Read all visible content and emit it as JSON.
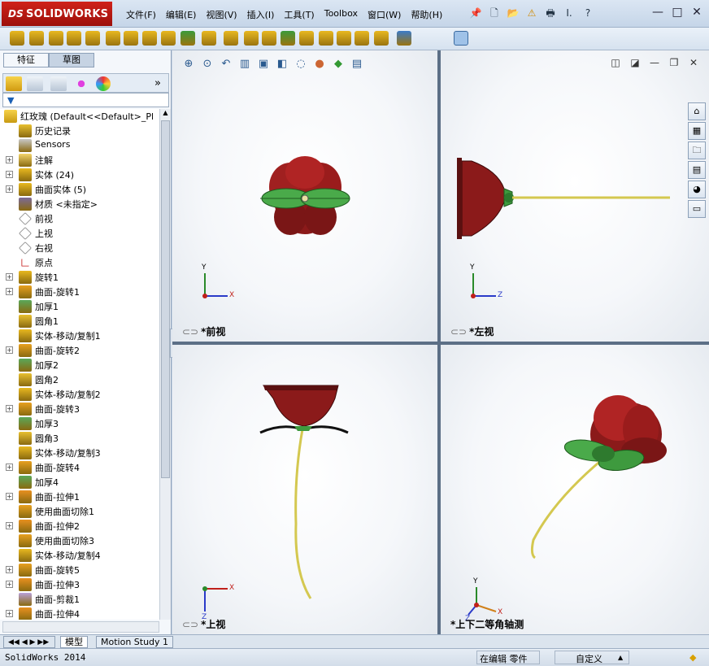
{
  "app": {
    "logo_prefix": "DS",
    "logo_text": "SOLIDWORKS"
  },
  "menu": [
    "文件(F)",
    "编辑(E)",
    "视图(V)",
    "插入(I)",
    "工具(T)",
    "Toolbox",
    "窗口(W)",
    "帮助(H)"
  ],
  "topicons": [
    "pin-icon",
    "new-document-icon",
    "open-icon",
    "rebuild-warning-icon",
    "print-icon",
    "measure-icon",
    "help-icon"
  ],
  "window_buttons": [
    "—",
    "□",
    "✕"
  ],
  "feature_tabs": [
    "特征",
    "草图"
  ],
  "manager_buttons": [
    "feature-manager-icon",
    "property-manager-icon",
    "configuration-manager-icon",
    "dimxpert-icon",
    "display-manager-icon"
  ],
  "tree": {
    "root": "红玫瑰  (Default<<Default>_Pl",
    "items": [
      {
        "label": "历史记录",
        "icon": "history-icon",
        "exp": false
      },
      {
        "label": "Sensors",
        "icon": "sensors-icon",
        "exp": false
      },
      {
        "label": "注解",
        "icon": "annotations-icon",
        "exp": true
      },
      {
        "label": "实体 (24)",
        "icon": "solid-bodies-icon",
        "exp": true
      },
      {
        "label": "曲面实体 (5)",
        "icon": "surface-bodies-icon",
        "exp": true
      },
      {
        "label": "材质 <未指定>",
        "icon": "material-icon",
        "exp": false
      },
      {
        "label": "前视",
        "icon": "plane-icon",
        "exp": false
      },
      {
        "label": "上视",
        "icon": "plane-icon",
        "exp": false
      },
      {
        "label": "右视",
        "icon": "plane-icon",
        "exp": false
      },
      {
        "label": "原点",
        "icon": "origin-icon",
        "exp": false
      },
      {
        "label": "旋转1",
        "icon": "revolve-icon",
        "exp": true
      },
      {
        "label": "曲面-旋转1",
        "icon": "surface-revolve-icon",
        "exp": true
      },
      {
        "label": "加厚1",
        "icon": "thicken-icon",
        "exp": false
      },
      {
        "label": "圆角1",
        "icon": "fillet-icon",
        "exp": false
      },
      {
        "label": "实体-移动/复制1",
        "icon": "move-copy-icon",
        "exp": false
      },
      {
        "label": "曲面-旋转2",
        "icon": "surface-revolve-icon",
        "exp": true
      },
      {
        "label": "加厚2",
        "icon": "thicken-icon",
        "exp": false
      },
      {
        "label": "圆角2",
        "icon": "fillet-icon",
        "exp": false
      },
      {
        "label": "实体-移动/复制2",
        "icon": "move-copy-icon",
        "exp": false
      },
      {
        "label": "曲面-旋转3",
        "icon": "surface-revolve-icon",
        "exp": true
      },
      {
        "label": "加厚3",
        "icon": "thicken-icon",
        "exp": false
      },
      {
        "label": "圆角3",
        "icon": "fillet-icon",
        "exp": false
      },
      {
        "label": "实体-移动/复制3",
        "icon": "move-copy-icon",
        "exp": false
      },
      {
        "label": "曲面-旋转4",
        "icon": "surface-revolve-icon",
        "exp": true
      },
      {
        "label": "加厚4",
        "icon": "thicken-icon",
        "exp": false
      },
      {
        "label": "曲面-拉伸1",
        "icon": "surface-extrude-icon",
        "exp": true
      },
      {
        "label": "使用曲面切除1",
        "icon": "surface-cut-icon",
        "exp": false
      },
      {
        "label": "曲面-拉伸2",
        "icon": "surface-extrude-icon",
        "exp": true
      },
      {
        "label": "使用曲面切除3",
        "icon": "surface-cut-icon",
        "exp": false
      },
      {
        "label": "实体-移动/复制4",
        "icon": "move-copy-icon",
        "exp": false
      },
      {
        "label": "曲面-旋转5",
        "icon": "surface-revolve-icon",
        "exp": true
      },
      {
        "label": "曲面-拉伸3",
        "icon": "surface-extrude-icon",
        "exp": true
      },
      {
        "label": "曲面-剪裁1",
        "icon": "surface-trim-icon",
        "exp": false
      },
      {
        "label": "曲面-拉伸4",
        "icon": "surface-extrude-icon",
        "exp": true
      }
    ]
  },
  "viewports": [
    {
      "name": "front",
      "label": "*前视",
      "axes": [
        "Y",
        "X"
      ]
    },
    {
      "name": "left",
      "label": "*左视",
      "axes": [
        "Y",
        "Z"
      ]
    },
    {
      "name": "top",
      "label": "*上视",
      "axes": [
        "X",
        "Z"
      ]
    },
    {
      "name": "iso",
      "label": "*上下二等角轴测",
      "axes": [
        "Y",
        "X",
        "Z"
      ]
    }
  ],
  "task_pane": [
    "home-icon",
    "design-library-icon",
    "file-explorer-icon",
    "view-palette-icon",
    "appearances-icon",
    "custom-properties-icon"
  ],
  "bottom_tabs": [
    "模型",
    "Motion Study 1"
  ],
  "status": {
    "app_version": "SolidWorks 2014",
    "mode": "在编辑 零件",
    "units": "自定义",
    "units_arrow": "▲"
  },
  "colors": {
    "petal": "#8b1a1a",
    "leaf": "#3e9a3e",
    "stem": "#d4c850",
    "accent_red": "#c8201a"
  }
}
